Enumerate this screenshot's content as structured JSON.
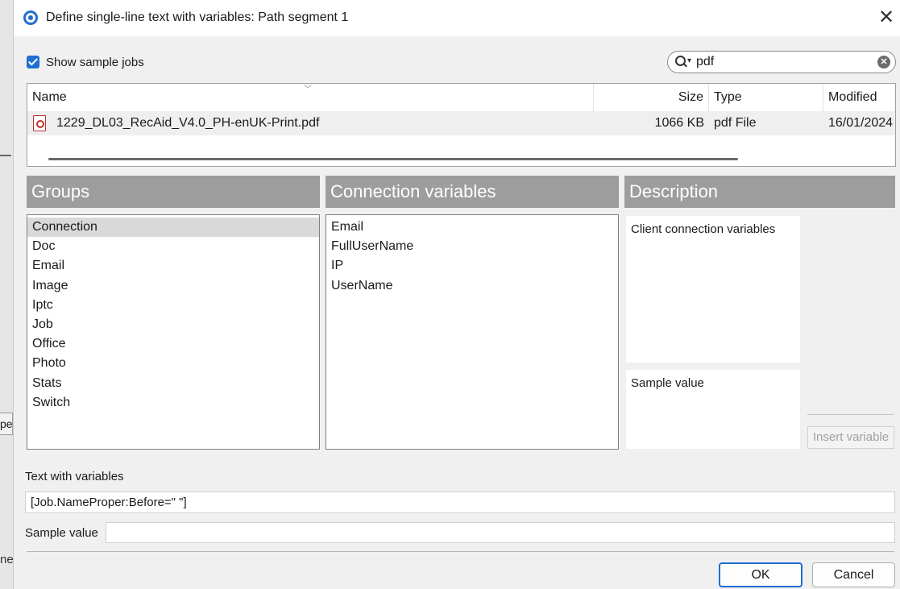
{
  "background": {
    "fragment_top": "pe",
    "fragment_bottom": "ne"
  },
  "dialog": {
    "title": "Define single-line text with variables: Path segment 1",
    "close_glyph": "✕"
  },
  "sample_jobs": {
    "label": "Show sample jobs",
    "checked": true
  },
  "search": {
    "value": "pdf"
  },
  "files": {
    "columns": [
      "Name",
      "Size",
      "Type",
      "Modified"
    ],
    "rows": [
      {
        "name": "1229_DL03_RecAid_V4.0_PH-enUK-Print.pdf",
        "size": "1066 KB",
        "type": "pdf File",
        "modified": "16/01/2024"
      }
    ]
  },
  "groups": {
    "header": "Groups",
    "items": [
      "Connection",
      "Doc",
      "Email",
      "Image",
      "Iptc",
      "Job",
      "Office",
      "Photo",
      "Stats",
      "Switch"
    ],
    "selected": "Connection"
  },
  "variables": {
    "header": "Connection variables",
    "items": [
      "Email",
      "FullUserName",
      "IP",
      "UserName"
    ]
  },
  "description": {
    "header": "Description",
    "text": "Client connection variables",
    "sample_value_label": "Sample value"
  },
  "insert_variable_label": "Insert variable",
  "text_with_variables": {
    "label": "Text with variables",
    "value": "[Job.NameProper:Before=\" \"]"
  },
  "sample_value": {
    "label": "Sample value",
    "value": ""
  },
  "buttons": {
    "ok": "OK",
    "cancel": "Cancel"
  },
  "colors": {
    "accent": "#1f6fd0",
    "panel_header": "#9d9d9d",
    "dialog_bg": "#f0f0f0",
    "selected_row": "#d9d9d9"
  }
}
